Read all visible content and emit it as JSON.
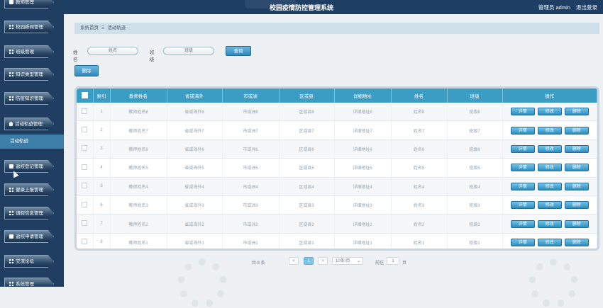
{
  "app": {
    "title": "校园疫情防控管理系统"
  },
  "topbar": {
    "role": "管理员 admin",
    "logout": "退出登录"
  },
  "sidebar": {
    "items": [
      {
        "label": "教师管理",
        "icon": "doc-icon"
      },
      {
        "label": "校园新闻管理",
        "icon": "grid-icon"
      },
      {
        "label": "班级管理",
        "icon": "grid-icon"
      },
      {
        "label": "知识类型管理",
        "icon": "grid-icon"
      },
      {
        "label": "防疫知识管理",
        "icon": "grid-icon"
      },
      {
        "label": "活动轨迹管理",
        "icon": "person-icon"
      },
      {
        "label": "返校登记管理",
        "icon": "doc-icon"
      },
      {
        "label": "健康上报管理",
        "icon": "grid-icon"
      },
      {
        "label": "请假信息管理",
        "icon": "grid-icon"
      },
      {
        "label": "返校申请管理",
        "icon": "doc-icon"
      },
      {
        "label": "交流论坛",
        "icon": "grid-icon"
      },
      {
        "label": "系统管理",
        "icon": "grid-icon"
      }
    ],
    "active_sub": "活动轨迹"
  },
  "breadcrumb": {
    "home": "系统首页",
    "separator": "Ξ",
    "current": "活动轨迹"
  },
  "search": {
    "name_label": "姓名",
    "name_placeholder": "姓名",
    "class_label": "班级",
    "class_placeholder": "班级",
    "query_button": "查询"
  },
  "toolbar": {
    "delete_button": "删除"
  },
  "table": {
    "headers": [
      "",
      "索引",
      "教师姓名",
      "省或海外",
      "市或洲",
      "区或县",
      "详细地址",
      "姓名",
      "班级",
      "操作"
    ],
    "actions": {
      "detail": "详情",
      "edit": "修改",
      "delete": "删除"
    },
    "rows": [
      [
        "1",
        "教师姓名8",
        "省或海外8",
        "市或洲8",
        "区或县8",
        "详细地址8",
        "姓名8",
        "班级8"
      ],
      [
        "2",
        "教师姓名7",
        "省或海外7",
        "市或洲7",
        "区或县7",
        "详细地址7",
        "姓名7",
        "班级7"
      ],
      [
        "3",
        "教师姓名6",
        "省或海外6",
        "市或洲6",
        "区或县6",
        "详细地址6",
        "姓名6",
        "班级6"
      ],
      [
        "4",
        "教师姓名5",
        "省或海外5",
        "市或洲5",
        "区或县5",
        "详细地址5",
        "姓名5",
        "班级5"
      ],
      [
        "5",
        "教师姓名4",
        "省或海外4",
        "市或洲4",
        "区或县4",
        "详细地址4",
        "姓名4",
        "班级4"
      ],
      [
        "6",
        "教师姓名3",
        "省或海外3",
        "市或洲3",
        "区或县3",
        "详细地址3",
        "姓名3",
        "班级3"
      ],
      [
        "7",
        "教师姓名2",
        "省或海外2",
        "市或洲2",
        "区或县2",
        "详细地址2",
        "姓名2",
        "班级2"
      ],
      [
        "8",
        "教师姓名1",
        "省或海外1",
        "市或洲1",
        "区或县1",
        "详细地址1",
        "姓名1",
        "班级1"
      ]
    ]
  },
  "pagination": {
    "total": "共 8 条",
    "prev": "<",
    "current_page": "1",
    "next": ">",
    "page_size": "10条/页",
    "goto_label": "前往",
    "goto_value": "1",
    "page_suffix": "页"
  },
  "colors": {
    "sidebar_bg": "#1f3e62",
    "accent": "#3b9dc4",
    "active_sub": "#3d7ea8"
  }
}
